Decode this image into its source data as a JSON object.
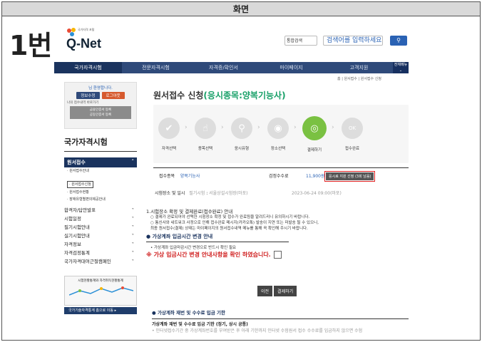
{
  "caption": "화면",
  "step_number": "1번",
  "logo": {
    "brand": "Q-Net",
    "tagline": "국가자격 포털"
  },
  "search": {
    "scope": "통합검색",
    "keyword": "검색어를 입력하세요",
    "button_icon": "search-icon"
  },
  "gnb": {
    "items": [
      "국가자격시험",
      "전문자격시험",
      "자격증/확인서",
      "마이페이지",
      "고객지원"
    ],
    "all_menu": "전체메뉴"
  },
  "breadcrumb": "홈 | 원서접수 | 원서접수 신청",
  "login_box": {
    "welcome": "님 환영합니다.",
    "info_button": "정보수정",
    "logout_button": "로그아웃",
    "recent": "나의 접수내역 바로가기",
    "links": [
      "금융인증서 등록",
      "공동인증서 등록"
    ]
  },
  "lnb": {
    "title": "국가자격시험",
    "active_menu": "원서접수",
    "sub_items": [
      "원서접수안내",
      "원서접수신청",
      "원서접수현황",
      "장애유형별편의제공안내"
    ],
    "menus": [
      "합격자/답안발표",
      "시험일정",
      "필기시험안내",
      "실기시험안내",
      "자격정보",
      "자격검정통계",
      "국가자격대여근절캠페인"
    ]
  },
  "banner": {
    "text": "시험현황통계와 자격취득현황통계",
    "button": "국가기술자격통계 홈으로 이동"
  },
  "page": {
    "title_prefix": "원서접수 신청",
    "title_highlight": "(응시종목:양복기능사)"
  },
  "steps": [
    {
      "label": "자격선택",
      "icon": "check-icon"
    },
    {
      "label": "종목선택",
      "icon": "hand-icon"
    },
    {
      "label": "응시유형",
      "icon": "search-icon"
    },
    {
      "label": "장소선택",
      "icon": "location-icon"
    },
    {
      "label": "결제하기",
      "icon": "payment-icon"
    },
    {
      "label": "접수완료",
      "icon": "ok-icon"
    }
  ],
  "exam_info": {
    "item_label": "접수종목",
    "item_value": "양복기능사",
    "fee_label": "검정수수료",
    "fee_value": "11,900원",
    "alt_select_button": "응시료 지원 선정 (3회 남음)",
    "site_label": "시험장소 및 일시",
    "site_type": "필기시험",
    "site_value": "서울상설시험장(마포)",
    "datetime": "2023-06-24 09:00(마포)"
  },
  "notice": {
    "heading": "1.시험장소 확정 및 결제완료(접수완료) 안내",
    "lines": [
      "○ 결제가 완료되어야 선택한 시험장소 확정 및 접수가 완료됨을 알려드리니 유의하시기 바랍니다.",
      "○ 통신사와 네트워크 사정으로 인해 접수완료 메시지(카카오톡) 발송이 지연 또는 미발송 될 수 있으니,",
      "   최종 원서접수(결제) 상태는 마이페이지의 원서접수내역 메뉴를 통해 꼭 확인해 주시기 바랍니다."
    ],
    "sec1": "가상계좌 입금시간 변경 안내",
    "sec1_text": "• 가상계좌 입금마감시간 변경으로 반드시 확인 필요",
    "warn": "※ 가상 입금시간 변경 안내사항을 확인 하였습니다."
  },
  "actions": {
    "prev": "이전",
    "pay": "결제하기"
  },
  "tail": {
    "heading": "가상계좌 재번 및 수수료 입금 기한",
    "line1": "가상계좌 재번 및 수수료 입금 기한 (정기, 상시 공통)",
    "line2": "• 인터넷접수기간 중 가상계좌번호를 부여받은 후 아래 기한까지 인터넷 수험원서 접수 수수료를 입금하지 않으면 수험"
  }
}
